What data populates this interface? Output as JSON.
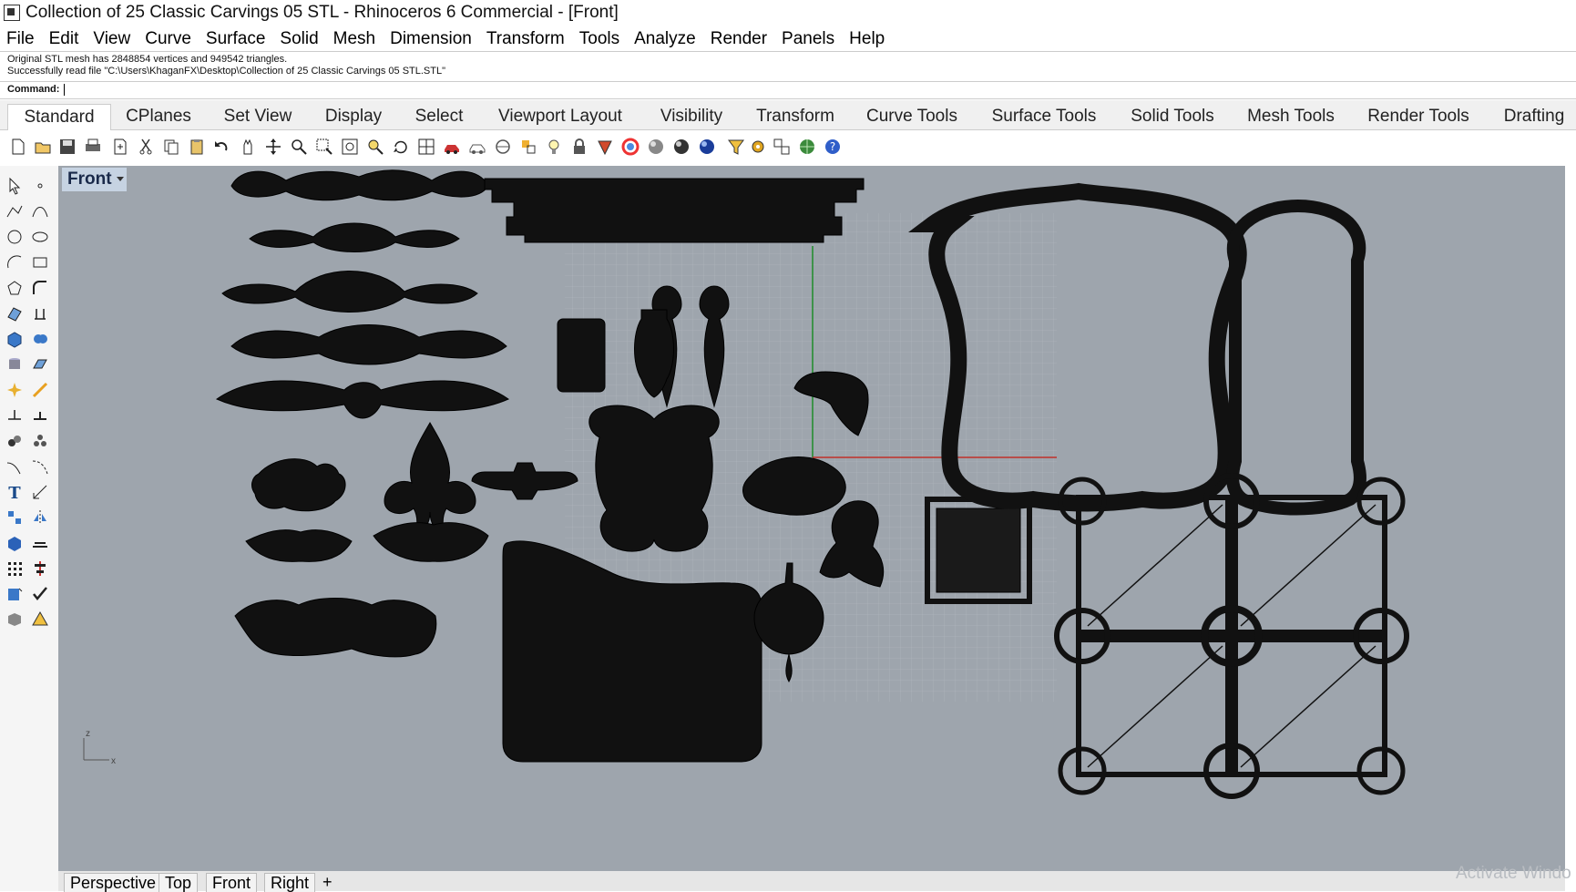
{
  "window": {
    "title": "Collection of 25 Classic Carvings 05 STL - Rhinoceros 6 Commercial - [Front]"
  },
  "menu": [
    "File",
    "Edit",
    "View",
    "Curve",
    "Surface",
    "Solid",
    "Mesh",
    "Dimension",
    "Transform",
    "Tools",
    "Analyze",
    "Render",
    "Panels",
    "Help"
  ],
  "command_history": [
    "Original STL mesh has 2848854 vertices and 949542 triangles.",
    "Successfully read file \"C:\\Users\\KhaganFX\\Desktop\\Collection of 25 Classic Carvings 05 STL.STL\""
  ],
  "command_prompt": {
    "label": "Command:",
    "value": ""
  },
  "toolbar_tabs": [
    "Standard",
    "CPlanes",
    "Set View",
    "Display",
    "Select",
    "Viewport Layout",
    "Visibility",
    "Transform",
    "Curve Tools",
    "Surface Tools",
    "Solid Tools",
    "Mesh Tools",
    "Render Tools",
    "Drafting"
  ],
  "active_tab": "Standard",
  "toolbar_icons": [
    "new-icon",
    "open-icon",
    "save-icon",
    "print-icon",
    "import-icon",
    "cut-icon",
    "copy-icon",
    "paste-icon",
    "undo-icon",
    "pan-icon",
    "move-icon",
    "zoom-icon",
    "zoom-window-icon",
    "zoom-extents-icon",
    "zoom-selected-icon",
    "rotate-view-icon",
    "four-views-icon",
    "car-icon",
    "car-outline-icon",
    "cplane-icon",
    "osnap-icon",
    "light-icon",
    "lock-icon",
    "material-icon",
    "color-wheel-icon",
    "sphere-gray-icon",
    "sphere-shaded-icon",
    "sphere-blue-icon",
    "filter-icon",
    "gear-icon",
    "layout-icon",
    "globe-icon",
    "help-icon"
  ],
  "viewport": {
    "name": "Front",
    "axis_label_z": "z",
    "axis_label_x": "x",
    "colors": {
      "background": "#9ea5ad",
      "grid": "#aeb4bb",
      "x_axis": "#c0302a",
      "y_axis": "#1f8c2a",
      "mesh": "#111111"
    }
  },
  "viewport_tabs": [
    "Perspective",
    "Top",
    "Front",
    "Right"
  ],
  "watermark": "Activate Windo"
}
